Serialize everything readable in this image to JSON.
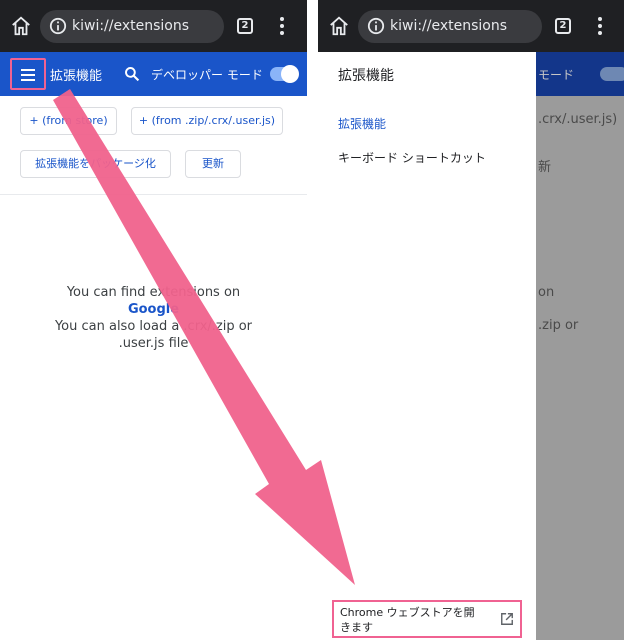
{
  "browser": {
    "url": "kiwi://extensions",
    "tab_count": "2"
  },
  "extensions_page": {
    "title": "拡張機能",
    "developer_mode_label": "デベロッパー モード",
    "developer_mode_on": true,
    "buttons": {
      "from_store": "+ (from store)",
      "from_file": "+ (from .zip/.crx/.user.js)",
      "pack": "拡張機能をパッケージ化",
      "update": "更新"
    },
    "empty_line1": "You can find extensions on",
    "empty_link": "Google",
    "empty_line2": "You can also load a .crx/.zip or",
    "empty_line3": ".user.js file"
  },
  "drawer": {
    "title": "拡張機能",
    "items": [
      {
        "label": "拡張機能",
        "active": true
      },
      {
        "label": "キーボード ショートカット",
        "active": false
      }
    ],
    "footer_line1": "Chrome ウェブストアを開",
    "footer_line2": "きます"
  },
  "background_fragments": {
    "mode": "モード",
    "btn": ".crx/.user.js)",
    "update": "新",
    "on": "on",
    "zip": ".zip or"
  },
  "colors": {
    "accent": "#1a55c9",
    "highlight": "#f06292",
    "arrow": "#f0628c"
  }
}
